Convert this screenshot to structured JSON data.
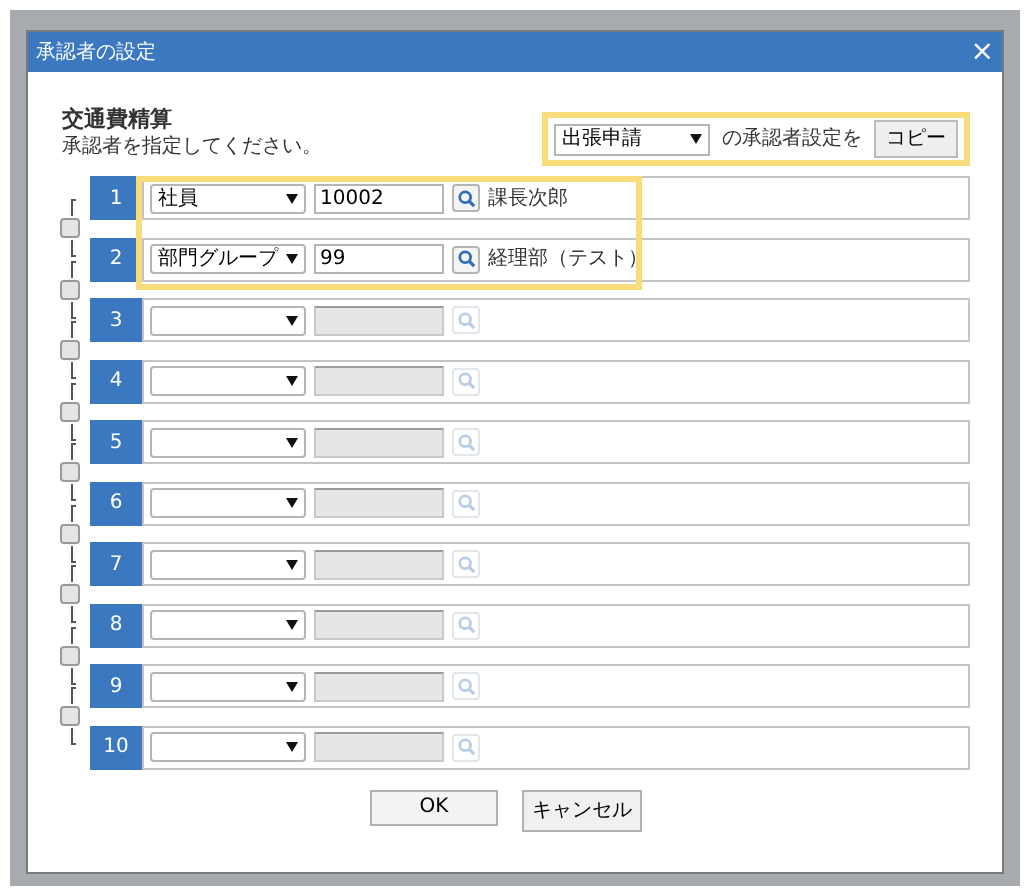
{
  "window": {
    "title": "承認者の設定",
    "close": "×"
  },
  "heading": "交通費精算",
  "instruction": "承認者を指定してください。",
  "copy": {
    "source": "出張申請",
    "label": "の承認者設定を",
    "button": "コピー"
  },
  "rows": [
    {
      "number": "1",
      "type": "社員",
      "code": "10002",
      "name": "課長次郎",
      "enabled": true
    },
    {
      "number": "2",
      "type": "部門グループ",
      "code": "99",
      "name": "経理部（テスト）",
      "enabled": true
    },
    {
      "number": "3",
      "enabled": false
    },
    {
      "number": "4",
      "enabled": false
    },
    {
      "number": "5",
      "enabled": false
    },
    {
      "number": "6",
      "enabled": false
    },
    {
      "number": "7",
      "enabled": false
    },
    {
      "number": "8",
      "enabled": false
    },
    {
      "number": "9",
      "enabled": false
    },
    {
      "number": "10",
      "enabled": false
    }
  ],
  "buttons": [
    "OK",
    "キャンセル"
  ]
}
